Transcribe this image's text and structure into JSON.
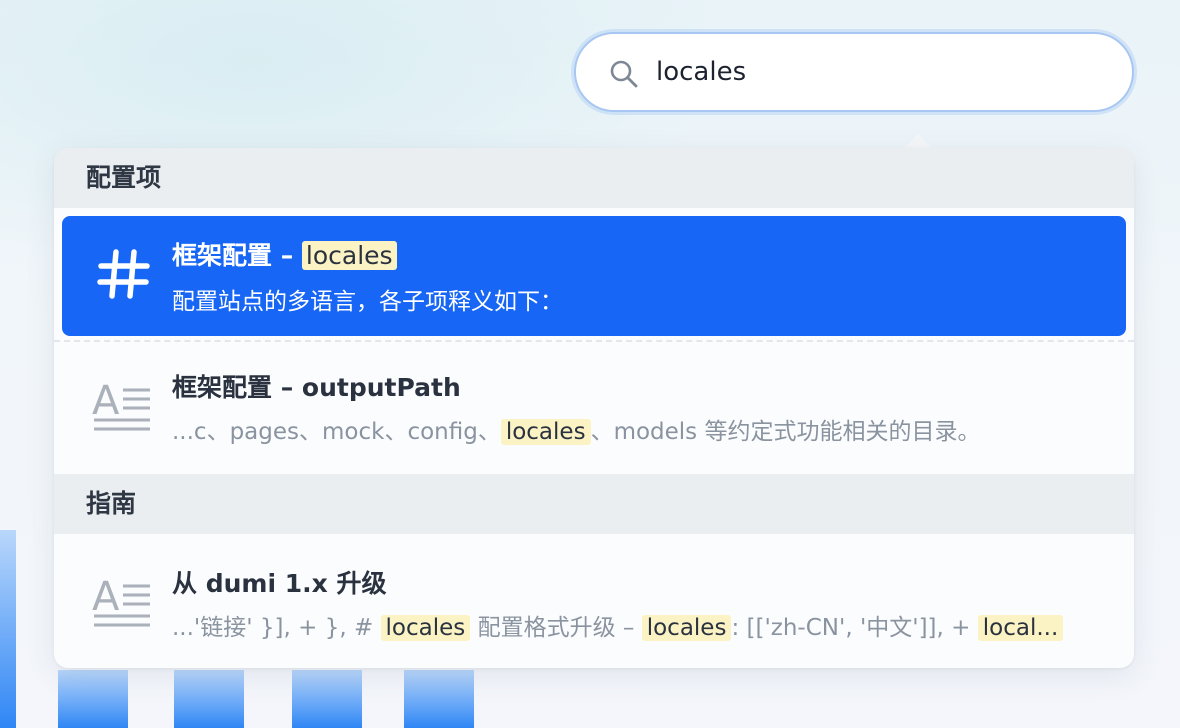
{
  "search": {
    "value": "locales",
    "placeholder": ""
  },
  "groups": [
    {
      "title": "配置项",
      "results": [
        {
          "icon": "hash-icon",
          "active": true,
          "title_prefix": "框架配置 – ",
          "title_highlight": "locales",
          "desc": "配置站点的多语言，各子项释义如下："
        },
        {
          "icon": "doc-text-icon",
          "active": false,
          "title": "框架配置 – outputPath",
          "desc_before": "...c、pages、mock、config、",
          "desc_highlight": "locales",
          "desc_after": "、models 等约定式功能相关的目录。"
        }
      ]
    },
    {
      "title": "指南",
      "results": [
        {
          "icon": "doc-text-icon",
          "active": false,
          "title": "从 dumi 1.x 升级",
          "desc_part1": "...'链接' }], + }, # ",
          "desc_hl1": "locales",
          "desc_part2": " 配置格式升级 – ",
          "desc_hl2": "locales",
          "desc_part3": ": [['zh-CN', '中文']], + ",
          "desc_hl3": "local..."
        }
      ]
    }
  ],
  "colors": {
    "active_bg": "#1766f5",
    "highlight_bg": "#fbf3c4",
    "group_head_bg": "#ebeef1",
    "search_border": "#a8c6f2"
  }
}
